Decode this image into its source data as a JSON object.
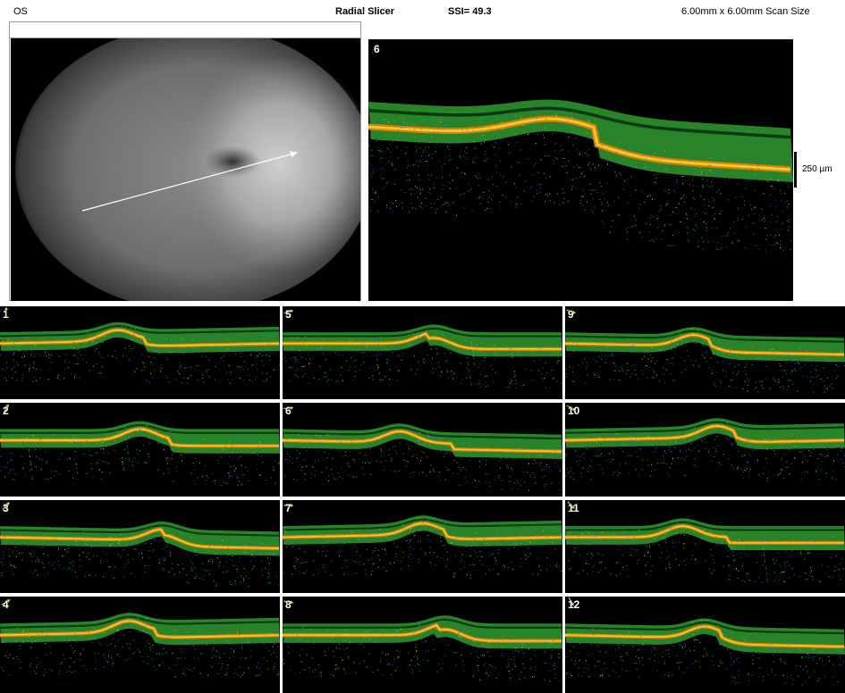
{
  "header": {
    "eye": "OS",
    "title": "Radial Slicer",
    "ssi": "SSI= 49.3",
    "scan_size": "6.00mm x 6.00mm Scan Size"
  },
  "main_scan": {
    "label": "6"
  },
  "scale": {
    "label": "250 µm"
  },
  "colors": {
    "retina_green": "#3fbf3a",
    "rpe_orange": "#e07a12",
    "arrow": "#e8d070",
    "background": "#000000"
  },
  "thumbnails": [
    {
      "label": "1"
    },
    {
      "label": "2"
    },
    {
      "label": "3"
    },
    {
      "label": "4"
    },
    {
      "label": "5"
    },
    {
      "label": "6"
    },
    {
      "label": "7"
    },
    {
      "label": "8"
    },
    {
      "label": "9"
    },
    {
      "label": "10"
    },
    {
      "label": "11"
    },
    {
      "label": "12"
    }
  ]
}
